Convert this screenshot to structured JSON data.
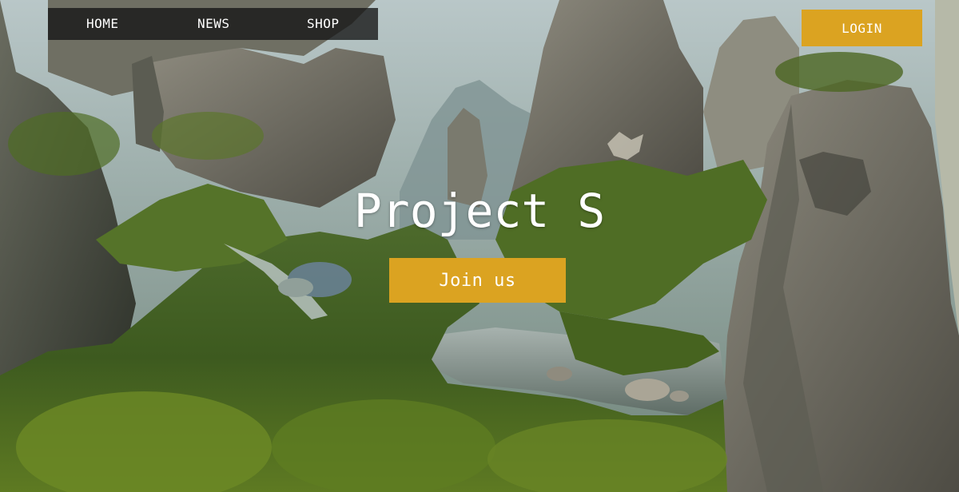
{
  "nav": {
    "items": [
      {
        "label": "HOME"
      },
      {
        "label": "NEWS"
      },
      {
        "label": "SHOP"
      }
    ]
  },
  "header": {
    "login_label": "LOGIN"
  },
  "hero": {
    "title": "Project S",
    "cta_label": "Join us"
  },
  "colors": {
    "accent": "#dba321",
    "nav_background": "#141414",
    "text": "#ffffff"
  }
}
